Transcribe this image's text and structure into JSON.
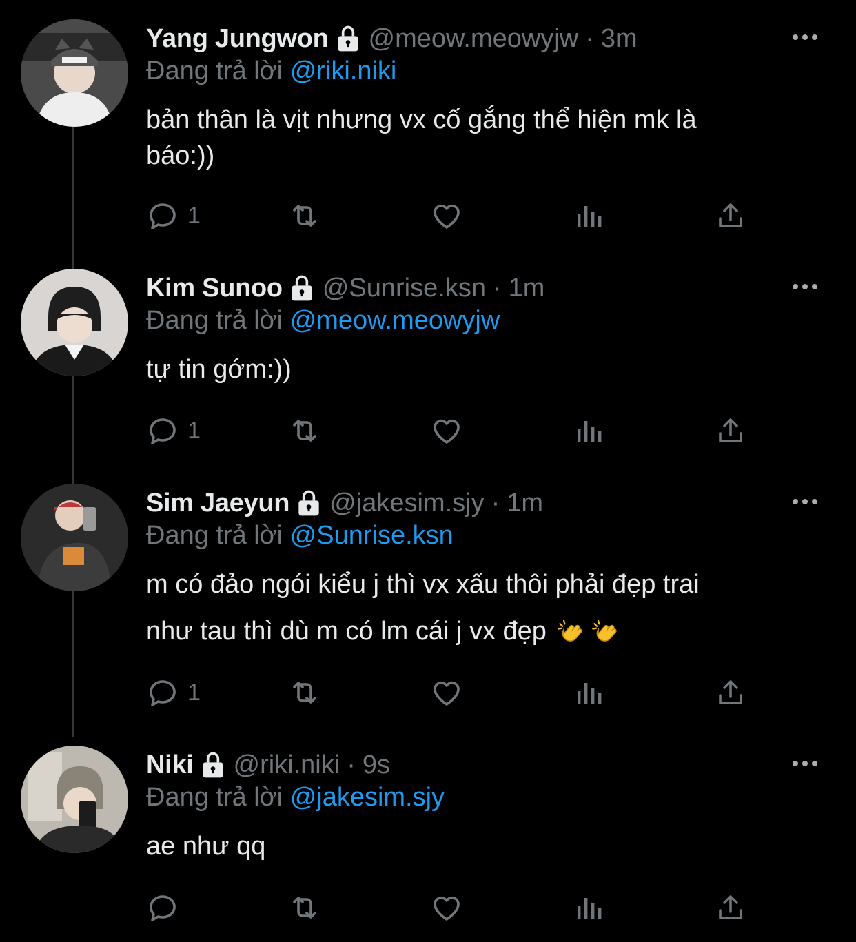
{
  "colors": {
    "background": "#000000",
    "text": "#e7e9ea",
    "muted": "#71767b",
    "link": "#1d9bf0",
    "thread_line": "#333639"
  },
  "icons": {
    "lock": "lock-icon",
    "more": "more-icon",
    "reply": "reply-icon",
    "retweet": "retweet-icon",
    "like": "heart-icon",
    "views": "views-icon",
    "share": "share-icon",
    "emoji": "clapping-hands-emoji"
  },
  "tweets": [
    {
      "name": "Yang Jungwon",
      "handle": "@meow.meowyjw",
      "dot": "·",
      "time": "3m",
      "reply_prefix": "Đang trả lời",
      "reply_mention": "@riki.niki",
      "text_line1": "bản thân là vịt nhưng vx cố gắng thể hiện mk là",
      "text_line2": "báo:))",
      "reply_count": "1"
    },
    {
      "name": "Kim Sunoo",
      "handle": "@Sunrise.ksn",
      "dot": "·",
      "time": "1m",
      "reply_prefix": "Đang trả lời",
      "reply_mention": "@meow.meowyjw",
      "text_line1": "tự tin gớm:))",
      "reply_count": "1"
    },
    {
      "name": "Sim Jaeyun",
      "handle": "@jakesim.sjy",
      "dot": "·",
      "time": "1m",
      "reply_prefix": "Đang trả lời",
      "reply_mention": "@Sunrise.ksn",
      "text_line1": "m có đảo ngói kiểu j thì vx xấu thôi phải đẹp trai",
      "text_line2": "như tau thì dù m có lm cái j vx đẹp",
      "reply_count": "1"
    },
    {
      "name": "Niki",
      "handle": "@riki.niki",
      "dot": "·",
      "time": "9s",
      "reply_prefix": "Đang trả lời",
      "reply_mention": "@jakesim.sjy",
      "text_line1": "ae như qq",
      "reply_count": ""
    }
  ]
}
